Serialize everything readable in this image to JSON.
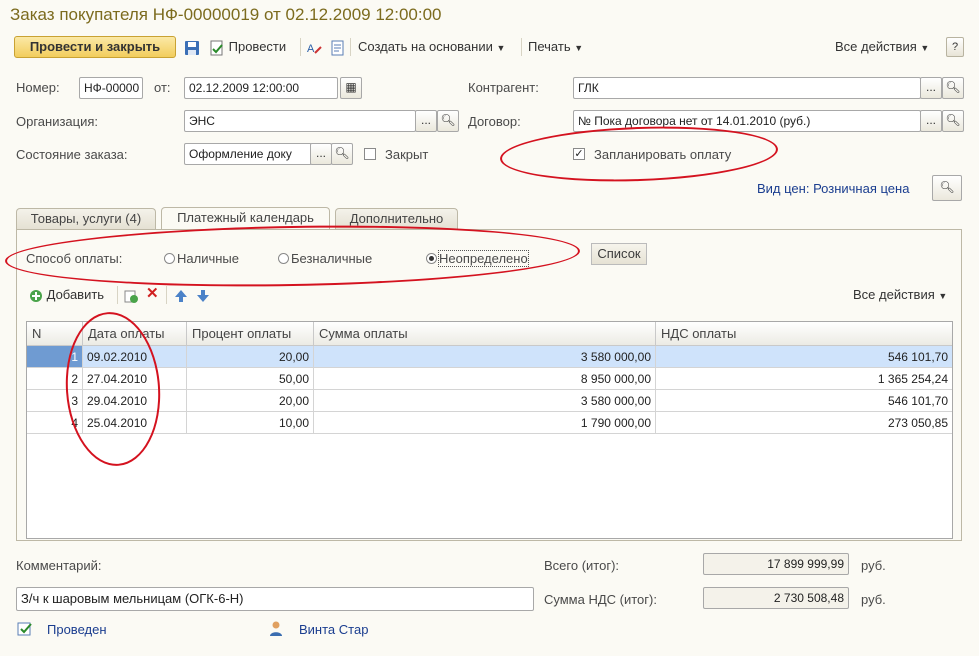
{
  "window": {
    "title": "Заказ покупателя НФ-00000019 от 02.12.2009 12:00:00"
  },
  "toolbar": {
    "post_close": "Провести и закрыть",
    "post": "Провести",
    "create_based": "Создать на основании",
    "print": "Печать",
    "all_actions": "Все действия"
  },
  "header": {
    "number_label": "Номер:",
    "number_value": "НФ-00000",
    "from_label": "от:",
    "date_value": "02.12.2009 12:00:00",
    "contractor_label": "Контрагент:",
    "contractor_value": "ГЛК",
    "org_label": "Организация:",
    "org_value": "ЭНС",
    "contract_label": "Договор:",
    "contract_value": "№ Пока договора нет от 14.01.2010 (руб.)",
    "status_label": "Состояние заказа:",
    "status_value": "Оформление доку",
    "closed_label": "Закрыт",
    "plan_payment_label": "Запланировать оплату",
    "plan_payment_checked": true,
    "price_type": "Вид цен: Розничная цена"
  },
  "tabs": [
    "Товары, услуги (4)",
    "Платежный календарь",
    "Дополнительно"
  ],
  "payment": {
    "method_label": "Способ оплаты:",
    "options": [
      "Наличные",
      "Безналичные",
      "Неопределено"
    ],
    "selected": "Неопределено",
    "list_button": "Список"
  },
  "grid_toolbar": {
    "add": "Добавить",
    "all_actions": "Все действия"
  },
  "table": {
    "columns": [
      "N",
      "Дата оплаты",
      "Процент оплаты",
      "Сумма оплаты",
      "НДС оплаты"
    ],
    "rows": [
      [
        "1",
        "09.02.2010",
        "20,00",
        "3 580 000,00",
        "546 101,70"
      ],
      [
        "2",
        "27.04.2010",
        "50,00",
        "8 950 000,00",
        "1 365 254,24"
      ],
      [
        "3",
        "29.04.2010",
        "20,00",
        "3 580 000,00",
        "546 101,70"
      ],
      [
        "4",
        "25.04.2010",
        "10,00",
        "1 790 000,00",
        "273 050,85"
      ]
    ]
  },
  "footer": {
    "comment_label": "Комментарий:",
    "comment_value": "З/ч к шаровым мельницам (ОГК-6-Н)",
    "total_label": "Всего (итог):",
    "total_value": "17 899 999,99",
    "total_currency": "руб.",
    "vat_label": "Сумма НДС (итог):",
    "vat_value": "2 730 508,48",
    "vat_currency": "руб.",
    "status_posted": "Проведен",
    "author": "Винта Стар"
  },
  "colors": {
    "title": "#7c6b1e",
    "accent_button": "#f2cd5d",
    "selection": "#cfe3fb",
    "annotation": "#d4121f",
    "link": "#1a3d8f"
  }
}
